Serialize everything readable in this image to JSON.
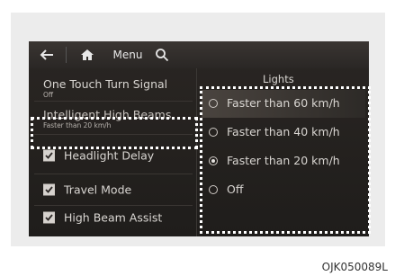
{
  "topbar": {
    "back_icon": "arrow-left-icon",
    "home_icon": "home-icon",
    "menu_label": "Menu",
    "search_icon": "search-icon"
  },
  "left_menu": {
    "one_touch": {
      "title": "One Touch Turn Signal",
      "subtitle": "Off"
    },
    "intelligent": {
      "title": "Intelligent High Beams",
      "subtitle": "Faster than 20 km/h"
    },
    "items": [
      {
        "label": "Headlight Delay",
        "checked": true
      },
      {
        "label": "Travel Mode",
        "checked": true
      },
      {
        "label": "High Beam Assist",
        "checked": true
      }
    ]
  },
  "right_panel": {
    "title": "Lights",
    "options": [
      {
        "label": "Faster than 60 km/h",
        "selected": false
      },
      {
        "label": "Faster than 40 km/h",
        "selected": false
      },
      {
        "label": "Faster than 20 km/h",
        "selected": true
      },
      {
        "label": "Off",
        "selected": false
      }
    ]
  },
  "caption": "OJK050089L",
  "colors": {
    "screen_bg": "#221f1d",
    "text": "#d9d6d2",
    "highlight": "#ffffff"
  }
}
